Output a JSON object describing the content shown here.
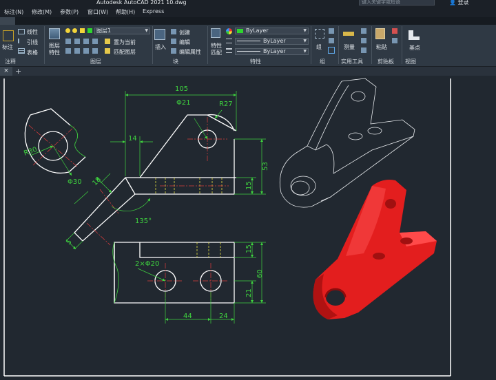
{
  "window": {
    "title": "Autodesk AutoCAD 2021    10.dwg"
  },
  "menu": [
    "标注(N)",
    "修改(M)",
    "参数(P)",
    "窗口(W)",
    "帮助(H)",
    "Express"
  ],
  "search": {
    "placeholder": "键入关键字或短语"
  },
  "user": {
    "login": "登录"
  },
  "ribbon": {
    "annotation": {
      "title": "注释",
      "dim_label": "标注",
      "linear": "线性",
      "leader": "引线",
      "table": "表格"
    },
    "layers": {
      "title": "图层",
      "props_label1": "图层",
      "props_label2": "特性",
      "current_layer": "图层1",
      "set_current": "置为当前",
      "match_layer": "匹配图层"
    },
    "block": {
      "title": "块",
      "insert": "插入",
      "create": "创建",
      "edit": "编辑",
      "edit_attr": "编辑属性"
    },
    "properties": {
      "title": "特性",
      "match1": "特性",
      "match2": "匹配",
      "color": "ByLayer",
      "linetype": "ByLayer",
      "lineweight": "ByLayer"
    },
    "group": {
      "title": "组",
      "label": "组"
    },
    "utilities": {
      "title": "实用工具",
      "measure": "测量"
    },
    "clipboard": {
      "title": "剪贴板",
      "paste": "粘贴"
    },
    "view": {
      "title": "视图",
      "base": "基点"
    }
  },
  "tabs": {
    "close": "×",
    "add": "+"
  },
  "drawing": {
    "dims": {
      "d105": "105",
      "d21": "Φ21",
      "r27": "R27",
      "d14": "14",
      "d53": "53",
      "d15a": "15",
      "d18": "18",
      "d135": "135°",
      "d30": "Φ30",
      "r30": "R30",
      "d5": "5",
      "d2x20": "2×Φ20",
      "d15b": "15",
      "d60": "60",
      "d21b": "21",
      "d44": "44",
      "d24": "24"
    },
    "colors": {
      "dim": "#3fd43f",
      "center": "#e03c3c",
      "hidden": "#e8e040",
      "object": "#ffffff",
      "solid": "#e31e1e"
    }
  }
}
